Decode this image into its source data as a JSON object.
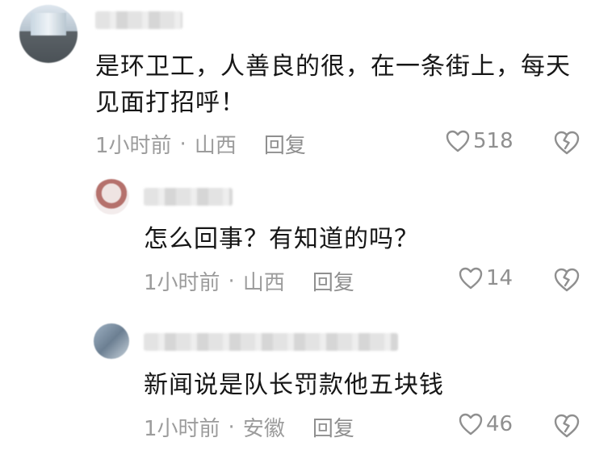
{
  "comments": [
    {
      "username": "▆▆▆▆▆",
      "text": "是环卫工，人善良的很，在一条街上，每天见面打招呼！",
      "time": "1小时前",
      "separator": "·",
      "location": "山西",
      "reply_label": "回复",
      "like_count": "518"
    },
    {
      "username": "▆▆▆▆▆▆",
      "text": "怎么回事？有知道的吗？",
      "time": "1小时前",
      "separator": "·",
      "location": "山西",
      "reply_label": "回复",
      "like_count": "14"
    },
    {
      "username": "▆▆▆▆▆▆▆▆▆▆▆▆▆▆▆",
      "text": "新闻说是队长罚款他五块钱",
      "time": "1小时前",
      "separator": "·",
      "location": "安徽",
      "reply_label": "回复",
      "like_count": "46"
    }
  ],
  "icons": {
    "like": "heart-outline-icon",
    "dislike": "broken-heart-icon"
  },
  "colors": {
    "text": "#161616",
    "meta": "#9c9c9c",
    "icon": "#8f8f8f"
  }
}
